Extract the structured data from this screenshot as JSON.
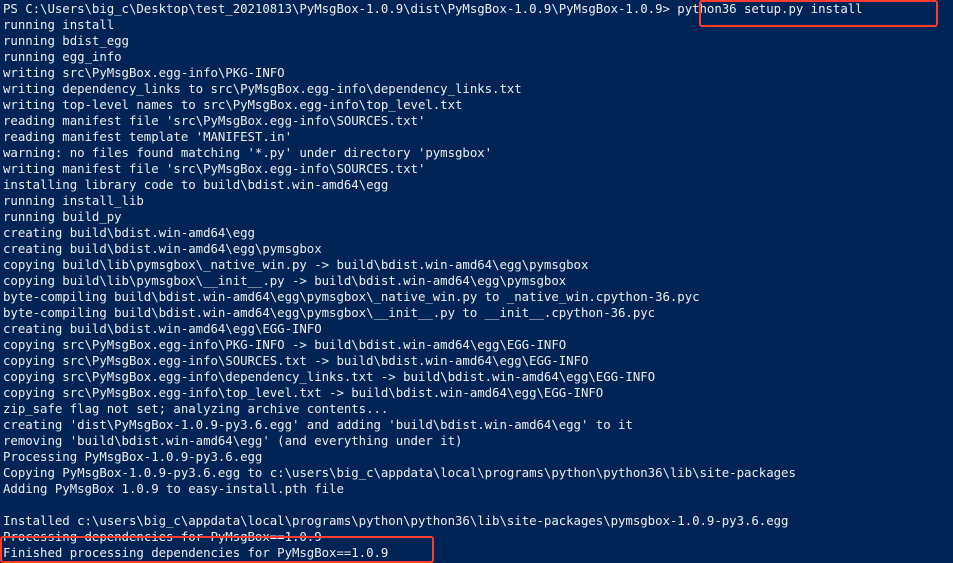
{
  "console": {
    "prompt": "PS C:\\Users\\big_c\\Desktop\\test_20210813\\PyMsgBox-1.0.9\\dist\\PyMsgBox-1.0.9\\PyMsgBox-1.0.9> ",
    "command": "python36 setup.py install",
    "lines": [
      "running install",
      "running bdist_egg",
      "running egg_info",
      "writing src\\PyMsgBox.egg-info\\PKG-INFO",
      "writing dependency_links to src\\PyMsgBox.egg-info\\dependency_links.txt",
      "writing top-level names to src\\PyMsgBox.egg-info\\top_level.txt",
      "reading manifest file 'src\\PyMsgBox.egg-info\\SOURCES.txt'",
      "reading manifest template 'MANIFEST.in'",
      "warning: no files found matching '*.py' under directory 'pymsgbox'",
      "writing manifest file 'src\\PyMsgBox.egg-info\\SOURCES.txt'",
      "installing library code to build\\bdist.win-amd64\\egg",
      "running install_lib",
      "running build_py",
      "creating build\\bdist.win-amd64\\egg",
      "creating build\\bdist.win-amd64\\egg\\pymsgbox",
      "copying build\\lib\\pymsgbox\\_native_win.py -> build\\bdist.win-amd64\\egg\\pymsgbox",
      "copying build\\lib\\pymsgbox\\__init__.py -> build\\bdist.win-amd64\\egg\\pymsgbox",
      "byte-compiling build\\bdist.win-amd64\\egg\\pymsgbox\\_native_win.py to _native_win.cpython-36.pyc",
      "byte-compiling build\\bdist.win-amd64\\egg\\pymsgbox\\__init__.py to __init__.cpython-36.pyc",
      "creating build\\bdist.win-amd64\\egg\\EGG-INFO",
      "copying src\\PyMsgBox.egg-info\\PKG-INFO -> build\\bdist.win-amd64\\egg\\EGG-INFO",
      "copying src\\PyMsgBox.egg-info\\SOURCES.txt -> build\\bdist.win-amd64\\egg\\EGG-INFO",
      "copying src\\PyMsgBox.egg-info\\dependency_links.txt -> build\\bdist.win-amd64\\egg\\EGG-INFO",
      "copying src\\PyMsgBox.egg-info\\top_level.txt -> build\\bdist.win-amd64\\egg\\EGG-INFO",
      "zip_safe flag not set; analyzing archive contents...",
      "creating 'dist\\PyMsgBox-1.0.9-py3.6.egg' and adding 'build\\bdist.win-amd64\\egg' to it",
      "removing 'build\\bdist.win-amd64\\egg' (and everything under it)",
      "Processing PyMsgBox-1.0.9-py3.6.egg",
      "Copying PyMsgBox-1.0.9-py3.6.egg to c:\\users\\big_c\\appdata\\local\\programs\\python\\python36\\lib\\site-packages",
      "Adding PyMsgBox 1.0.9 to easy-install.pth file",
      "",
      "Installed c:\\users\\big_c\\appdata\\local\\programs\\python\\python36\\lib\\site-packages\\pymsgbox-1.0.9-py3.6.egg",
      "Processing dependencies for PyMsgBox==1.0.9",
      "Finished processing dependencies for PyMsgBox==1.0.9"
    ]
  },
  "colors": {
    "background": "#012456",
    "text": "#eeedf0",
    "highlight": "#ff3b30"
  }
}
